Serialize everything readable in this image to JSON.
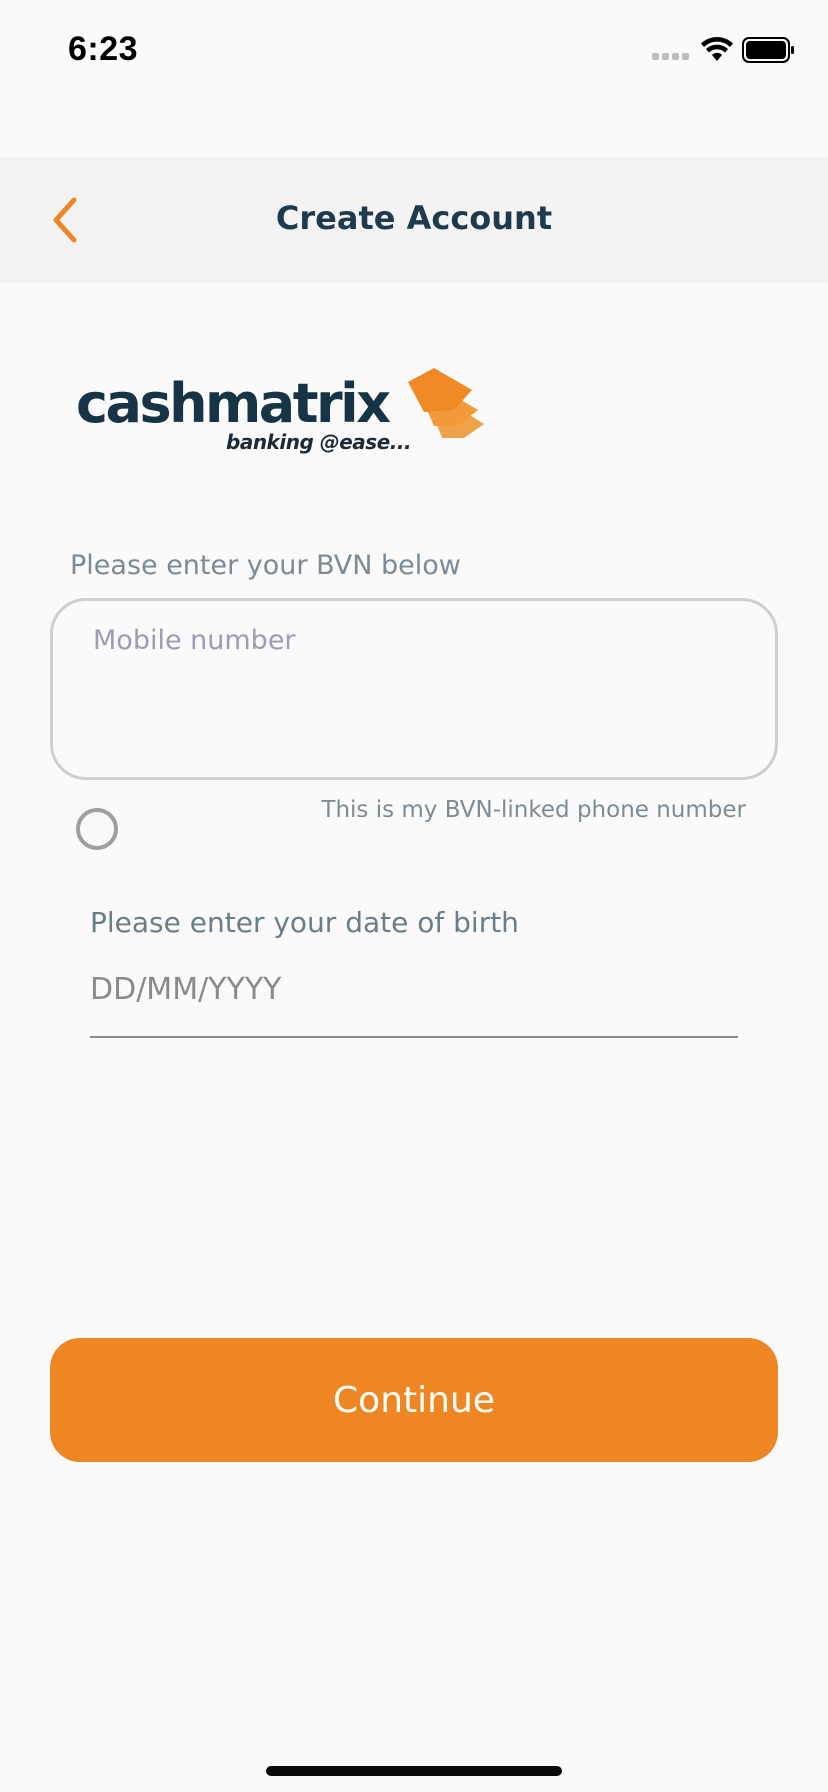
{
  "status_bar": {
    "time": "6:23",
    "icons": [
      "cellular-signal-icon",
      "wifi-icon",
      "battery-icon"
    ]
  },
  "nav": {
    "title": "Create Account",
    "back_icon": "chevron-left-icon"
  },
  "logo": {
    "wordmark": "cashmatrix",
    "tagline": "banking @ease..."
  },
  "form": {
    "bvn_label": "Please enter your BVN below",
    "mobile_placeholder": "Mobile number",
    "mobile_value": "",
    "linked_phone_label": "This is my BVN-linked phone number",
    "linked_phone_checked": false,
    "dob_label": "Please enter your date of birth",
    "dob_placeholder": "DD/MM/YYYY",
    "dob_value": ""
  },
  "actions": {
    "continue_label": "Continue"
  },
  "colors": {
    "accent": "#ee8624",
    "title": "#1f3a4d",
    "background": "#fafafa",
    "nav_background": "#f3f3f3"
  }
}
